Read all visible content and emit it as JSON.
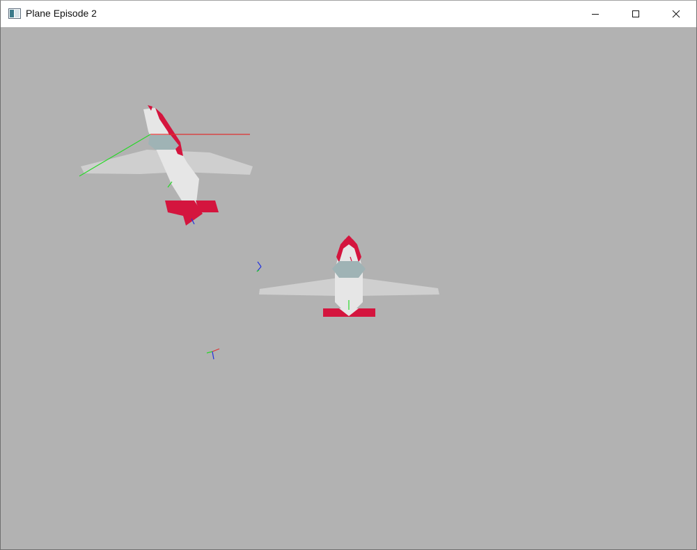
{
  "window": {
    "title": "Plane Episode 2",
    "icon": "app-window-icon"
  },
  "caption_buttons": {
    "minimize": "minimize-icon",
    "maximize": "maximize-icon",
    "close": "close-icon"
  },
  "scene": {
    "background_color": "#b2b2b2",
    "aircraft_count": 2,
    "axis_marker_count": 2,
    "colors": {
      "fuselage": "#e6e6e6",
      "wing": "#cfcfcf",
      "canopy": "#9fb3b5",
      "tail_accent": "#d4153e",
      "axis_x": "#e03030",
      "axis_y": "#27d827",
      "axis_z": "#2030e0"
    }
  }
}
